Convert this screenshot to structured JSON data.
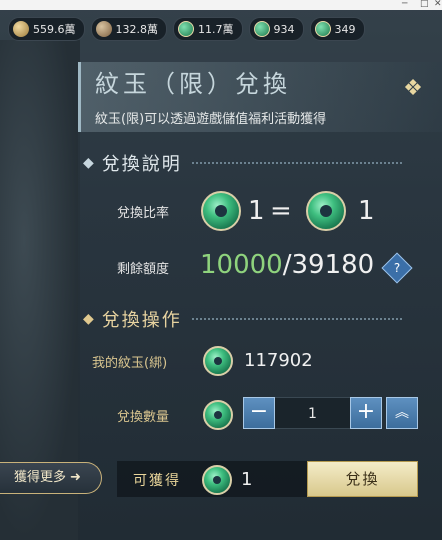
{
  "resources": [
    {
      "icon": "gold-ingot-icon",
      "value": "559.6萬"
    },
    {
      "icon": "coin-bag-icon",
      "value": "132.8萬"
    },
    {
      "icon": "jade-icon",
      "value": "11.7萬"
    },
    {
      "icon": "jade-plus-icon",
      "value": "934"
    },
    {
      "icon": "jade-plus-icon",
      "value": "349"
    }
  ],
  "panel": {
    "title": "紋玉（限）兌換",
    "subtitle": "紋玉(限)可以透過遊戲儲值福利活動獲得"
  },
  "explain_section": {
    "heading": "兌換說明",
    "ratio_label": "兌換比率",
    "ratio_left": "1",
    "ratio_eq": "=",
    "ratio_right": "1",
    "quota_label": "剩餘額度",
    "quota_used": "10000",
    "quota_total": "/39180",
    "help": "?"
  },
  "operate_section": {
    "heading": "兌換操作",
    "my_jade_label": "我的紋玉(綁)",
    "my_jade_value": "117902",
    "qty_label": "兌換數量",
    "qty_minus": "−",
    "qty_value": "1",
    "qty_plus": "+",
    "qty_max": "︽"
  },
  "bottom": {
    "get_more": "獲得更多",
    "get_more_arrow": "➜",
    "can_get_label": "可獲得",
    "can_get_value": "1",
    "exchange_button": "兌換"
  },
  "colors": {
    "quota_used": "#8fd37d",
    "accent_gold": "#d9c58f",
    "button_blue": "#4a7fb0"
  }
}
